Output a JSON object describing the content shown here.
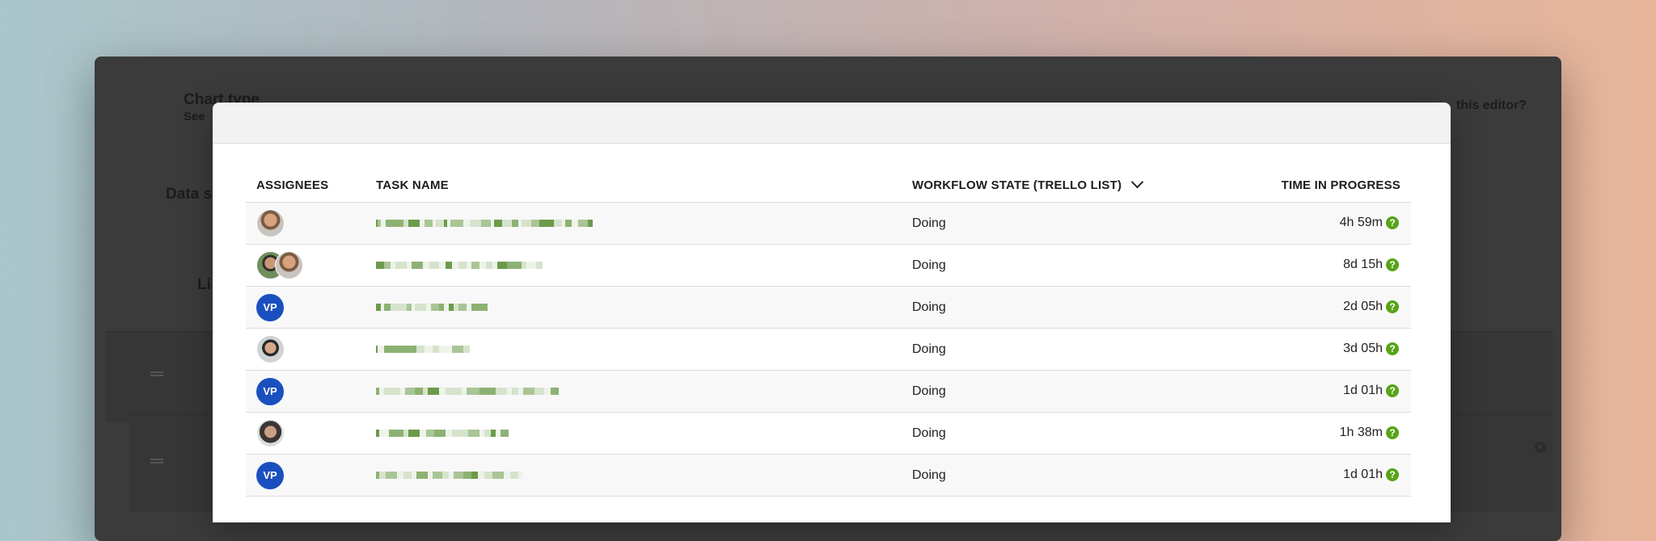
{
  "background": {
    "chart_type_title": "Chart type",
    "chart_type_sub": "See",
    "data_label": "Data s",
    "list_label": "Li",
    "help_text": "this editor?"
  },
  "table": {
    "headers": {
      "assignees": "ASSIGNEES",
      "task_name": "TASK NAME",
      "workflow_state": "WORKFLOW STATE (TRELLO LIST)",
      "time_in_progress": "TIME IN PROGRESS"
    },
    "rows": [
      {
        "assignees": [
          {
            "type": "photo",
            "style": "photo-a"
          }
        ],
        "state": "Doing",
        "time": "4h 59m"
      },
      {
        "assignees": [
          {
            "type": "photo",
            "style": "photo-b"
          },
          {
            "type": "photo",
            "style": "photo-a"
          }
        ],
        "state": "Doing",
        "time": "8d 15h"
      },
      {
        "assignees": [
          {
            "type": "initials",
            "text": "VP"
          }
        ],
        "state": "Doing",
        "time": "2d 05h"
      },
      {
        "assignees": [
          {
            "type": "photo",
            "style": "photo-c"
          }
        ],
        "state": "Doing",
        "time": "3d 05h"
      },
      {
        "assignees": [
          {
            "type": "initials",
            "text": "VP"
          }
        ],
        "state": "Doing",
        "time": "1d 01h"
      },
      {
        "assignees": [
          {
            "type": "photo",
            "style": "photo-d"
          }
        ],
        "state": "Doing",
        "time": "1h 38m"
      },
      {
        "assignees": [
          {
            "type": "initials",
            "text": "VP"
          }
        ],
        "state": "Doing",
        "time": "1d 01h"
      }
    ]
  },
  "icons": {
    "help": "?",
    "close": "×"
  },
  "colors": {
    "help_badge": "#58a318",
    "initials_avatar": "#1a4fbf"
  }
}
